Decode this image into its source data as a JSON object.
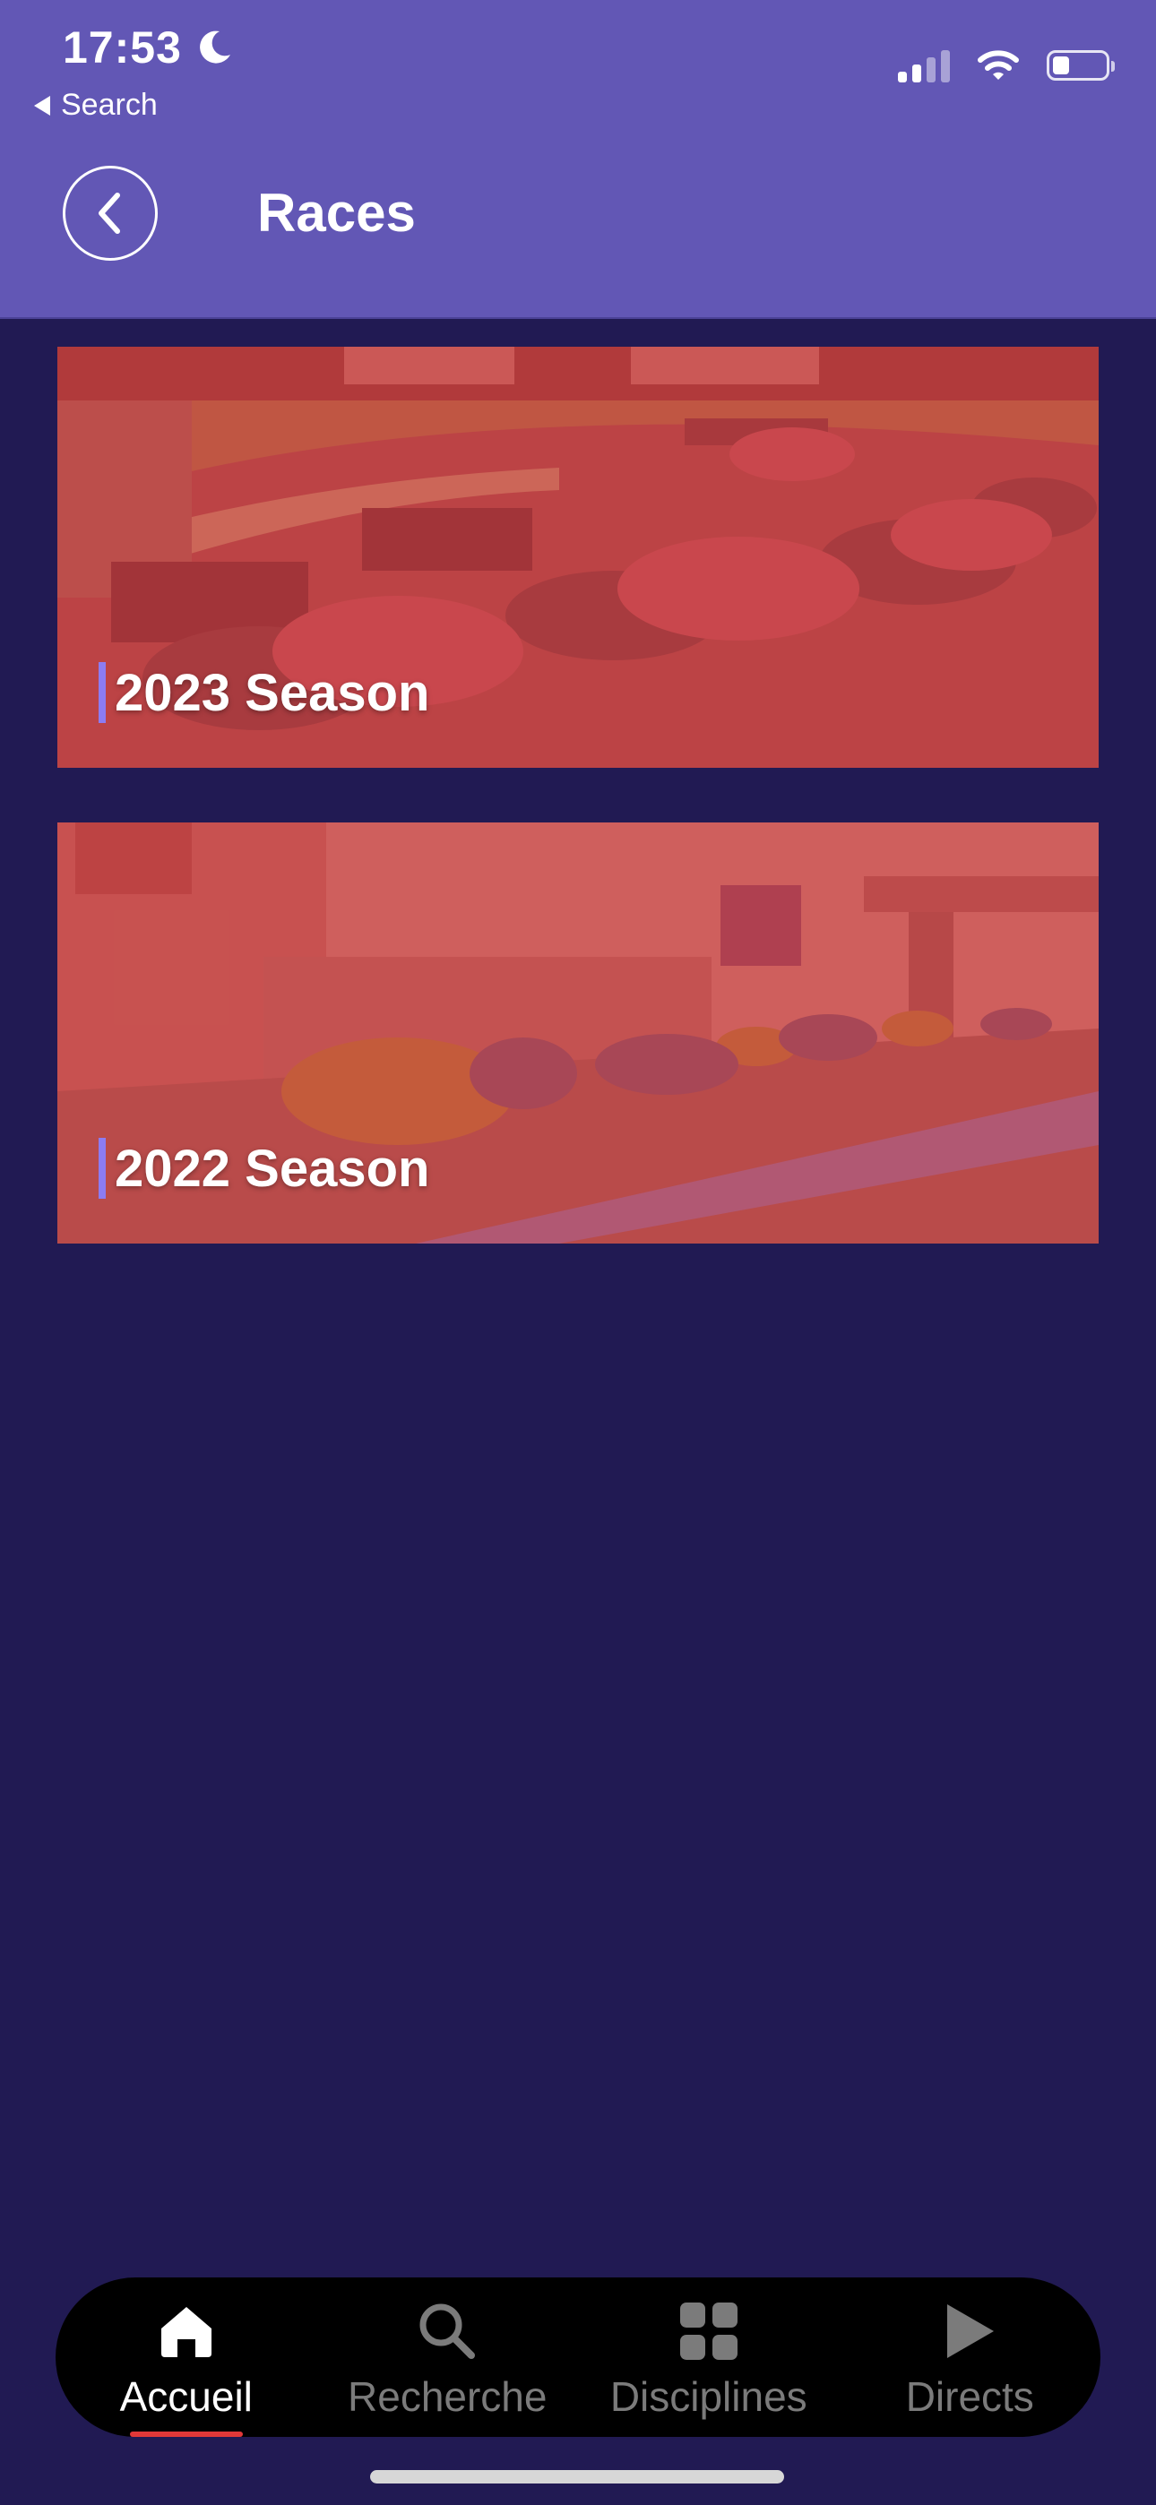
{
  "status_bar": {
    "time": "17:53",
    "back_label": "Search",
    "icons": [
      "moon-icon",
      "signal-icon",
      "wifi-icon",
      "battery-icon"
    ]
  },
  "header": {
    "title": "Races",
    "back_icon": "chevron-left-icon",
    "background": "#6257b5"
  },
  "seasons": [
    {
      "label": "2023 Season"
    },
    {
      "label": "2022 Season"
    }
  ],
  "tabbar": {
    "tabs": [
      {
        "label": "Accueil",
        "icon": "home-icon",
        "active": true
      },
      {
        "label": "Recherche",
        "icon": "search-icon",
        "active": false
      },
      {
        "label": "Disciplines",
        "icon": "grid-icon",
        "active": false
      },
      {
        "label": "Directs",
        "icon": "play-icon",
        "active": false
      }
    ],
    "active_color": "#ffffff",
    "inactive_color": "#7b7b7b",
    "indicator_color": "#e13838"
  },
  "colors": {
    "page_background": "#211a53",
    "accent": "#8c7cf2",
    "card_overlay": "#cd4648"
  }
}
